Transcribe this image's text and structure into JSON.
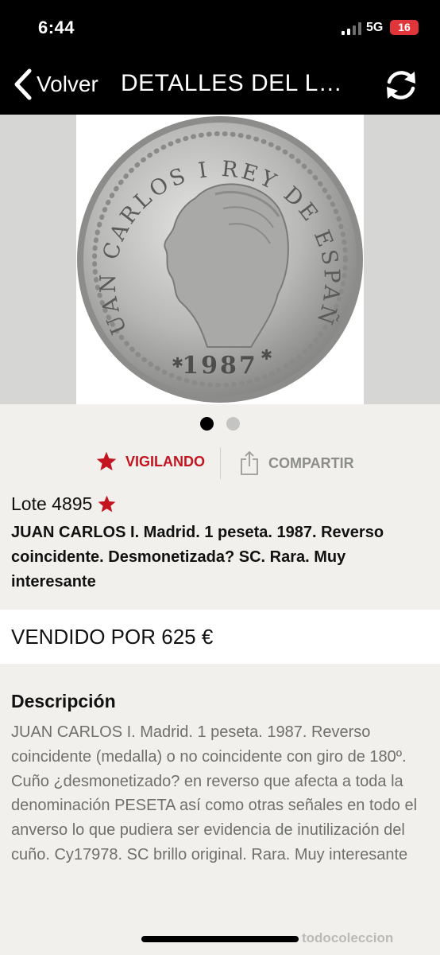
{
  "status_bar": {
    "time": "6:44",
    "network": "5G",
    "battery": "16"
  },
  "nav": {
    "back_label": "Volver",
    "title": "DETALLES DEL LOTE",
    "refresh_icon": "refresh-icon"
  },
  "coin": {
    "legend": "JUAN CARLOS I REY DE ESPAÑA",
    "year": "1987"
  },
  "gallery": {
    "total_images": 2,
    "active_index": 0
  },
  "actions": {
    "watch_label": "VIGILANDO",
    "share_label": "COMPARTIR",
    "watch_color": "#c41420",
    "share_color": "#8d8d8b"
  },
  "lot": {
    "label": "Lote 4895",
    "title": "JUAN CARLOS I. Madrid. 1 peseta. 1987. Reverso coincidente. Desmonetizada? SC. Rara. Muy interesante"
  },
  "price": {
    "text": "VENDIDO POR 625 €"
  },
  "description": {
    "heading": "Descripción",
    "body": "JUAN CARLOS I. Madrid. 1 peseta. 1987. Reverso coincidente (medalla) o no coincidente con giro de 180º. Cuño ¿desmonetizado? en reverso que afecta a toda la denominación PESETA así como otras señales en todo el anverso lo que pudiera ser evidencia de inutilización del cuño. Cy17978. SC brillo original. Rara. Muy interesante"
  },
  "watermark": "todocoleccion"
}
